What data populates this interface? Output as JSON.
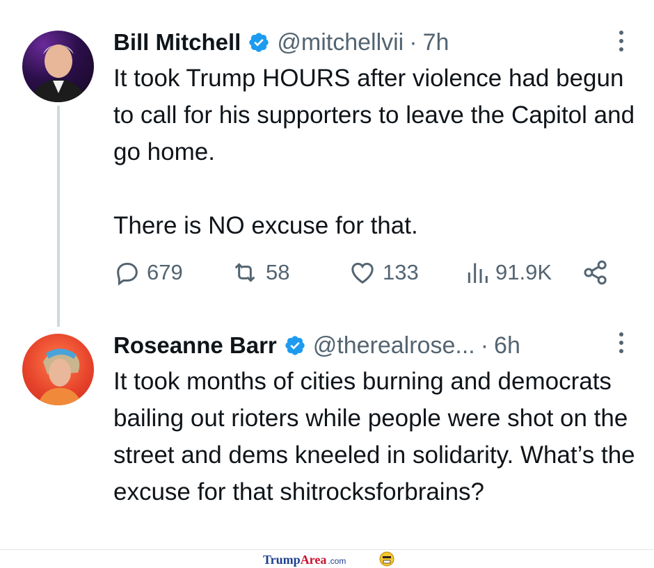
{
  "tweets": [
    {
      "name": "Bill Mitchell",
      "handle": "@mitchellvii",
      "separator": "·",
      "time": "7h",
      "paragraphs": [
        "It took Trump HOURS after violence had begun to call for his supporters to leave the Capitol and go home.",
        "There is NO excuse for that."
      ],
      "actions": {
        "replies": "679",
        "retweets": "58",
        "likes": "133",
        "views": "91.9K"
      }
    },
    {
      "name": "Roseanne Barr",
      "handle": "@therealrose...",
      "separator": "·",
      "time": "6h",
      "paragraphs": [
        "It took months of cities burning and democrats bailing out rioters while people were shot on the street and dems kneeled in solidarity. What’s the excuse for that shitrocksforbrains?"
      ]
    }
  ],
  "footer": {
    "brand_part1": "Trump",
    "brand_part2": "Area",
    "brand_part3": ".com"
  },
  "colors": {
    "verified": "#1d9bf0",
    "text": "#0f1419",
    "muted": "#536471",
    "thread_line": "#cfd9de"
  },
  "icons": [
    "verified-badge-icon",
    "more-options-icon",
    "reply-icon",
    "retweet-icon",
    "like-icon",
    "views-icon",
    "share-icon",
    "avatar",
    "emoji-icon"
  ]
}
